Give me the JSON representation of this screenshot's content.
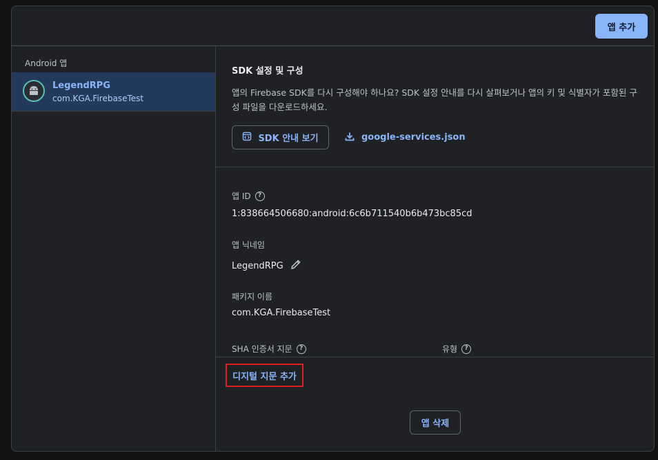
{
  "header": {
    "add_app_label": "앱 추가"
  },
  "sidebar": {
    "heading": "Android 앱",
    "apps": [
      {
        "name": "LegendRPG",
        "package": "com.KGA.FirebaseTest",
        "icon": "android-icon"
      }
    ]
  },
  "sdk": {
    "title": "SDK 설정 및 구성",
    "description": "앱의 Firebase SDK를 다시 구성해야 하나요? SDK 설정 안내를 다시 살펴보거나 앱의 키 및 식별자가 포함된 구성 파일을 다운로드하세요.",
    "guide_button_label": "SDK 안내 보기",
    "download_label": "google-services.json"
  },
  "details": {
    "app_id_label": "앱 ID",
    "app_id_value": "1:838664506680:android:6c6b711540b6b473bc85cd",
    "nickname_label": "앱 닉네임",
    "nickname_value": "LegendRPG",
    "package_label": "패키지 이름",
    "package_value": "com.KGA.FirebaseTest",
    "sha_label": "SHA 인증서 지문",
    "type_label": "유형"
  },
  "actions": {
    "add_fingerprint_label": "디지털 지문 추가",
    "delete_app_label": "앱 삭제"
  },
  "colors": {
    "accent": "#8ab4f8",
    "selected_bg": "#243a5c",
    "highlight_box": "#e02020"
  }
}
